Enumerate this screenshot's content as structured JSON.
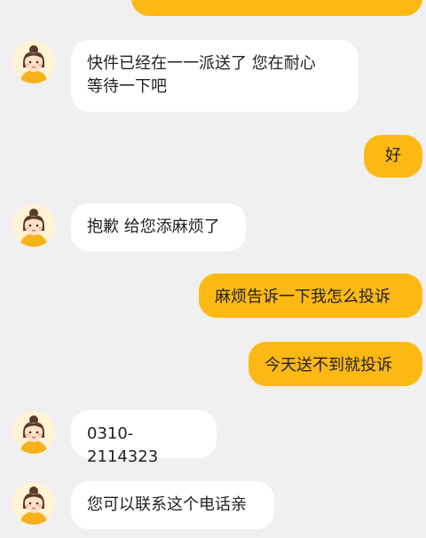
{
  "messages": [
    {
      "side": "out",
      "text": "",
      "partial": true
    },
    {
      "side": "in",
      "lines": [
        "快件已经在一一派送了 您在耐心",
        "等待一下吧"
      ]
    },
    {
      "side": "out",
      "text": "好"
    },
    {
      "side": "in",
      "text": "抱歉 给您添麻烦了"
    },
    {
      "side": "out",
      "text": "麻烦告诉一下我怎么投诉"
    },
    {
      "side": "out",
      "text": "今天送不到就投诉"
    },
    {
      "side": "in",
      "text": "0310-2114323"
    },
    {
      "side": "in",
      "text": "您可以联系这个电话亲"
    }
  ],
  "colors": {
    "background": "#f0f0f0",
    "incoming_bubble": "#ffffff",
    "outgoing_bubble": "#fdb913"
  },
  "avatar_icon": "girl-avatar-icon"
}
